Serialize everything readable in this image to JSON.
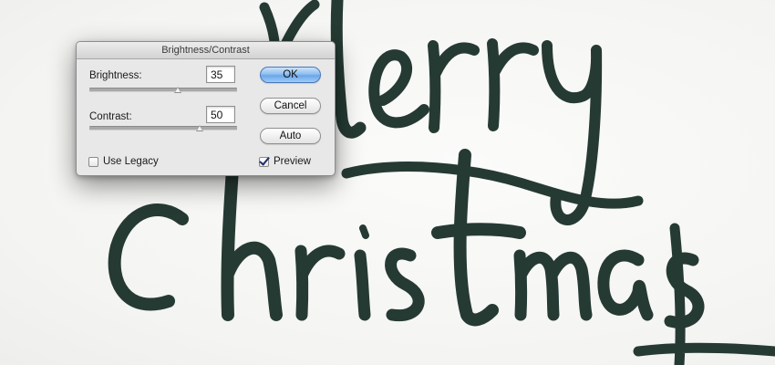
{
  "dialog": {
    "title": "Brightness/Contrast",
    "brightness": {
      "label": "Brightness:",
      "value": "35",
      "slider_fraction": 0.6
    },
    "contrast": {
      "label": "Contrast:",
      "value": "50",
      "slider_fraction": 0.75
    },
    "buttons": {
      "ok": "OK",
      "cancel": "Cancel",
      "auto": "Auto"
    },
    "use_legacy": {
      "label": "Use Legacy",
      "checked": false
    },
    "preview": {
      "label": "Preview",
      "checked": true
    }
  },
  "colors": {
    "ink": "#253a33",
    "default_button": "#6aa6ea"
  }
}
